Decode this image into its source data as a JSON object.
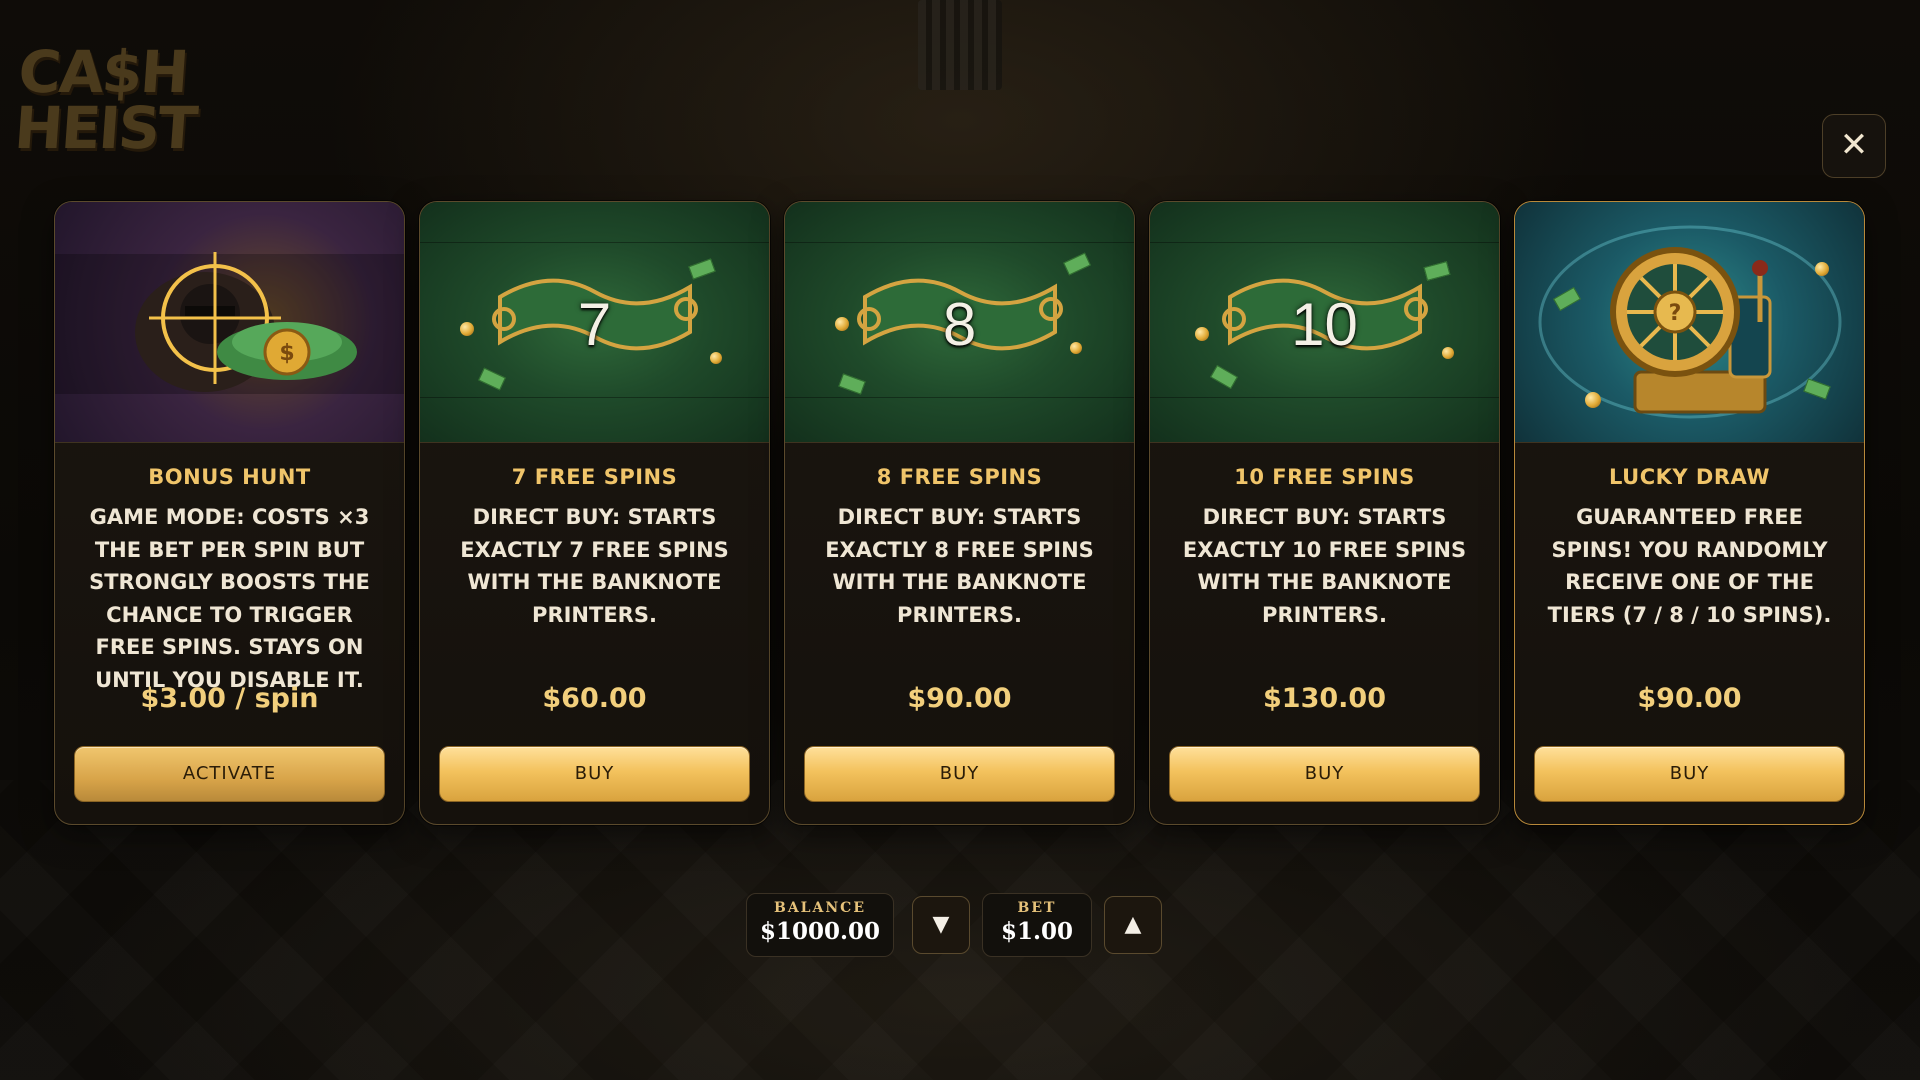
{
  "game": {
    "logo_line1": "CA$H",
    "logo_line2": "HEIST"
  },
  "close_button": {
    "icon": "close-icon",
    "symbol": "✕"
  },
  "cards": [
    {
      "art": "bonus-hunt-art",
      "title": "BONUS HUNT",
      "description": "GAME MODE: COSTS ×3 THE BET PER SPIN BUT STRONGLY BOOSTS THE CHANCE TO TRIGGER FREE SPINS. STAYS ON UNTIL YOU DISABLE IT.",
      "price": "$3.00 / spin",
      "button": "ACTIVATE"
    },
    {
      "art": "banknote-ribbon-art",
      "art_number": "7",
      "title": "7 FREE SPINS",
      "description": "DIRECT BUY: STARTS EXACTLY 7 FREE SPINS WITH THE BANKNOTE PRINTERS.",
      "price": "$60.00",
      "button": "BUY"
    },
    {
      "art": "banknote-ribbon-art",
      "art_number": "8",
      "title": "8 FREE SPINS",
      "description": "DIRECT BUY: STARTS EXACTLY 8 FREE SPINS WITH THE BANKNOTE PRINTERS.",
      "price": "$90.00",
      "button": "BUY"
    },
    {
      "art": "banknote-ribbon-art",
      "art_number": "10",
      "title": "10 FREE SPINS",
      "description": "DIRECT BUY: STARTS EXACTLY 10 FREE SPINS WITH THE BANKNOTE PRINTERS.",
      "price": "$130.00",
      "button": "BUY"
    },
    {
      "art": "lucky-wheel-art",
      "title": "LUCKY DRAW",
      "description": "GUARANTEED FREE SPINS! YOU RANDOMLY RECEIVE ONE OF THE TIERS (7 / 8 / 10 SPINS).",
      "price": "$90.00",
      "button": "BUY"
    }
  ],
  "footer": {
    "balance_label": "BALANCE",
    "balance_value": "$1000.00",
    "bet_label": "BET",
    "bet_value": "$1.00",
    "decrease_symbol": "▼",
    "increase_symbol": "▲"
  },
  "colors": {
    "accent_gold": "#f0c56a",
    "button_gold": "#f3c25d",
    "card_bg": "#1b1610"
  }
}
